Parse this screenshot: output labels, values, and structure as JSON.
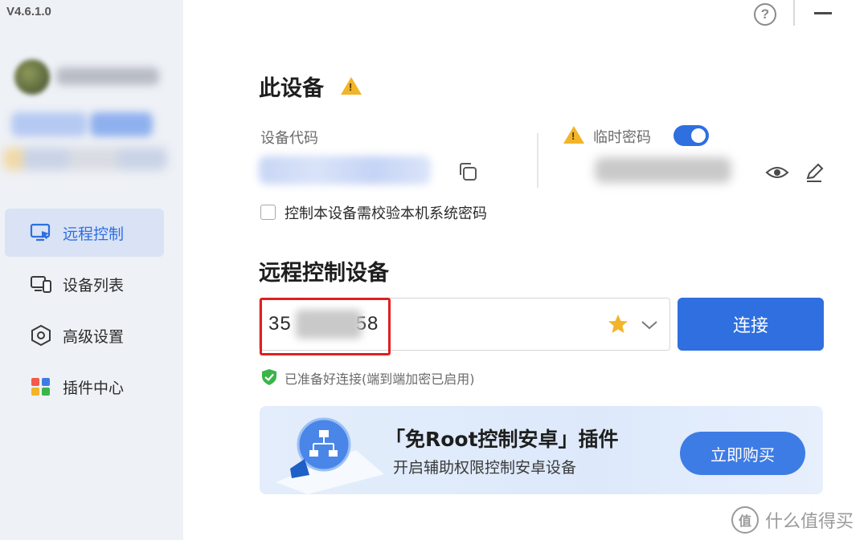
{
  "app": {
    "version": "V4.6.1.0"
  },
  "sidebar": {
    "items": [
      {
        "label": "远程控制",
        "icon": "monitor-remote-icon",
        "active": true
      },
      {
        "label": "设备列表",
        "icon": "devices-icon",
        "active": false
      },
      {
        "label": "高级设置",
        "icon": "hex-settings-icon",
        "active": false
      },
      {
        "label": "插件中心",
        "icon": "plugins-grid-icon",
        "active": false
      }
    ]
  },
  "this_device": {
    "title": "此设备",
    "device_code_label": "设备代码",
    "temp_password_label": "临时密码",
    "temp_password_enabled": true,
    "verify_system_password_label": "控制本设备需校验本机系统密码",
    "verify_system_password_checked": false
  },
  "remote": {
    "title": "远程控制设备",
    "input_value_prefix": "35",
    "input_value_suffix": "58",
    "connect_label": "连接",
    "status_text": "已准备好连接(端到端加密已启用)"
  },
  "banner": {
    "title": "「免Root控制安卓」插件",
    "subtitle": "开启辅助权限控制安卓设备",
    "button_label": "立即购买"
  },
  "watermark": {
    "text": "什么值得买",
    "logo_text": "值"
  },
  "colors": {
    "accent": "#2f6fe0",
    "sidebar_bg": "#eef1f6",
    "warning": "#f2b529",
    "success": "#3bb54a",
    "highlight_box": "#e02020"
  }
}
